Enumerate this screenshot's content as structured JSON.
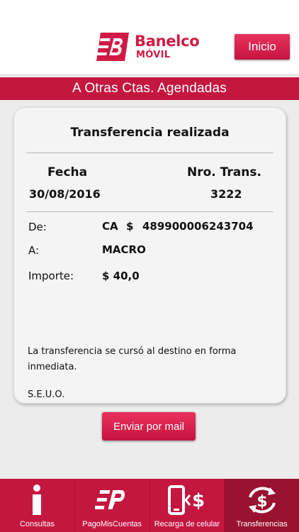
{
  "header": {
    "brand": "Banelco",
    "brand_sub": "MÓVIL",
    "home_label": "Inicio"
  },
  "section_title": "A Otras Ctas. Agendadas",
  "receipt": {
    "title": "Transferencia realizada",
    "date_label": "Fecha",
    "date_value": "30/08/2016",
    "trans_label": "Nro. Trans.",
    "trans_value": "3222",
    "from_label": "De:",
    "from_type": "CA",
    "from_currency": "$",
    "from_account": "489900006243704",
    "to_label": "A:",
    "to_value": "MACRO",
    "amount_label": "Importe:",
    "amount_value": "$ 40,0",
    "note_line1": "La transferencia se cursó al destino en forma",
    "note_line2": "inmediata.",
    "disclaimer": "S.E.U.O."
  },
  "email_button_label": "Enviar por mail",
  "nav": {
    "items": [
      {
        "label": "Consultas",
        "icon": "info-icon"
      },
      {
        "label": "PagoMisCuentas",
        "icon": "pagomiscuentas-icon"
      },
      {
        "label": "Recarga de celular",
        "icon": "phone-recharge-icon"
      },
      {
        "label": "Transferencias",
        "icon": "transfer-icon"
      }
    ],
    "active_index": 3
  },
  "colors": {
    "brand_red": "#c4173f",
    "active_tab": "#99122f"
  }
}
